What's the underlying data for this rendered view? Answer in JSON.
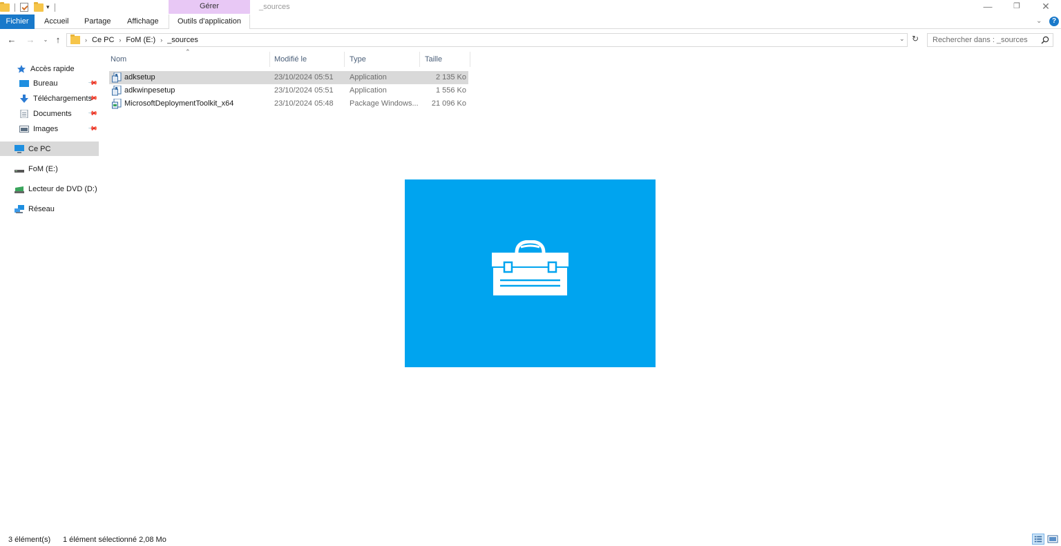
{
  "window": {
    "title": "_sources",
    "contextual_group": "Gérer",
    "controls": {
      "minimize": "—",
      "maximize": "❐",
      "close": "✕"
    }
  },
  "ribbon": {
    "tabs": [
      "Fichier",
      "Accueil",
      "Partage",
      "Affichage",
      "Outils d'application"
    ],
    "help_symbol": "?"
  },
  "address": {
    "breadcrumb": [
      "Ce PC",
      "FoM (E:)",
      "_sources"
    ],
    "search_placeholder": "Rechercher dans : _sources"
  },
  "navigation": {
    "items": [
      {
        "label": "Accès rapide",
        "icon": "star-pin-icon",
        "pinned": false
      },
      {
        "label": "Bureau",
        "icon": "desktop-icon",
        "pinned": true
      },
      {
        "label": "Téléchargements",
        "icon": "download-arrow-icon",
        "pinned": true
      },
      {
        "label": "Documents",
        "icon": "document-icon",
        "pinned": true
      },
      {
        "label": "Images",
        "icon": "pictures-icon",
        "pinned": true
      },
      {
        "label": "Ce PC",
        "icon": "computer-icon",
        "selected": true
      },
      {
        "label": "FoM (E:)",
        "icon": "drive-icon"
      },
      {
        "label": "Lecteur de DVD (D:) S",
        "icon": "dvd-drive-icon"
      },
      {
        "label": "Réseau",
        "icon": "network-icon"
      }
    ]
  },
  "columns": [
    "Nom",
    "Modifié le",
    "Type",
    "Taille"
  ],
  "files": [
    {
      "name": "adksetup",
      "modified": "23/10/2024 05:51",
      "type": "Application",
      "size": "2 135 Ko",
      "selected": true
    },
    {
      "name": "adkwinpesetup",
      "modified": "23/10/2024 05:51",
      "type": "Application",
      "size": "1 556 Ko"
    },
    {
      "name": "MicrosoftDeploymentToolkit_x64",
      "modified": "23/10/2024 05:48",
      "type": "Package Windows...",
      "size": "21 096 Ko"
    }
  ],
  "preview": {
    "background": "#00a4ef",
    "icon": "toolbox-icon"
  },
  "status": {
    "count": "3 élément(s)",
    "selection": "1 élément sélectionné  2,08 Mo"
  },
  "colors": {
    "accent": "#1979ca",
    "selection": "#d9d9d9",
    "contextual_tab": "#e8c8f5"
  }
}
